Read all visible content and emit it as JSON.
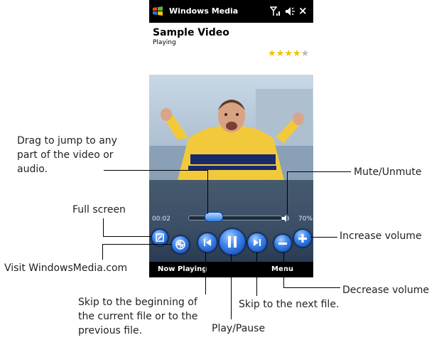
{
  "titlebar": {
    "app_title": "Windows Media",
    "close_label": "×"
  },
  "media": {
    "title": "Sample Video",
    "status": "Playing",
    "rating": 4,
    "rating_max": 5
  },
  "player": {
    "time_elapsed": "00:02",
    "volume_percent": "70%",
    "seek_progress": 0.2
  },
  "softkeys": {
    "left": "Now Playing",
    "right": "Menu"
  },
  "callouts": {
    "drag": [
      "Drag to jump to any",
      "part of the video or",
      "audio."
    ],
    "mute": "Mute/Unmute",
    "full_screen": "Full screen",
    "increase_volume": "Increase volume",
    "visit": "Visit WindowsMedia.com",
    "decrease_volume": "Decrease volume",
    "skip_begin": [
      "Skip to the beginning of",
      "the current file or to the",
      "previous file."
    ],
    "skip_next": "Skip to the next file.",
    "play_pause": "Play/Pause"
  },
  "icons": [
    "windows-flag-icon",
    "signal-icon",
    "volume-icon",
    "close-icon",
    "mute-icon",
    "fullscreen-icon",
    "globe-icon",
    "skip-back-icon",
    "pause-icon",
    "skip-forward-icon",
    "minus-icon",
    "plus-icon",
    "star-icon"
  ],
  "colors": {
    "accent": "#3d86ec",
    "star": "#f6c000",
    "titlebar": "#000000"
  }
}
